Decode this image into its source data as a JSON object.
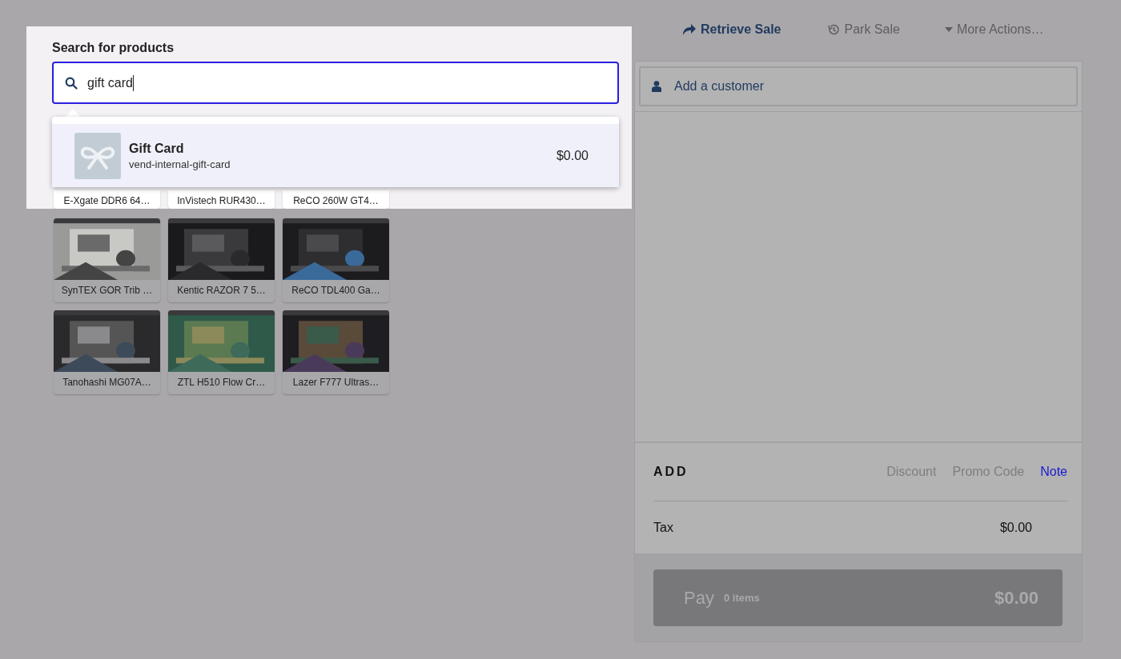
{
  "search": {
    "label": "Search for products",
    "value": "gift card"
  },
  "results": [
    {
      "name": "Gift Card",
      "sku": "vend-internal-gift-card",
      "price": "$0.00",
      "selected": true
    }
  ],
  "products": [
    {
      "name": "E-Xgate DDR6 64…"
    },
    {
      "name": "InVistech RUR430…"
    },
    {
      "name": "ReCO 260W GT4…"
    },
    {
      "name": "SynTEX GOR Trib …"
    },
    {
      "name": "Kentic RAZOR 7 5…"
    },
    {
      "name": "ReCO TDL400 Ga…"
    },
    {
      "name": "Tanohashi MG07A…"
    },
    {
      "name": "ZTL H510 Flow Cr…"
    },
    {
      "name": "Lazer F777 Ultras…"
    }
  ],
  "actions": [
    {
      "kind": "retrieve",
      "label": "Retrieve Sale",
      "disabled": false
    },
    {
      "kind": "park",
      "label": "Park Sale",
      "disabled": true
    },
    {
      "kind": "more",
      "label": "More Actions…",
      "disabled": true
    }
  ],
  "customer": {
    "placeholder": "Add a customer"
  },
  "add": {
    "title": "ADD",
    "links": [
      {
        "label": "Discount",
        "disabled": true
      },
      {
        "label": "Promo Code",
        "disabled": true
      },
      {
        "label": "Note",
        "disabled": false
      }
    ]
  },
  "tax": {
    "label": "Tax",
    "value": "$0.00"
  },
  "pay": {
    "label": "Pay",
    "count": "0 items",
    "amount": "$0.00"
  }
}
